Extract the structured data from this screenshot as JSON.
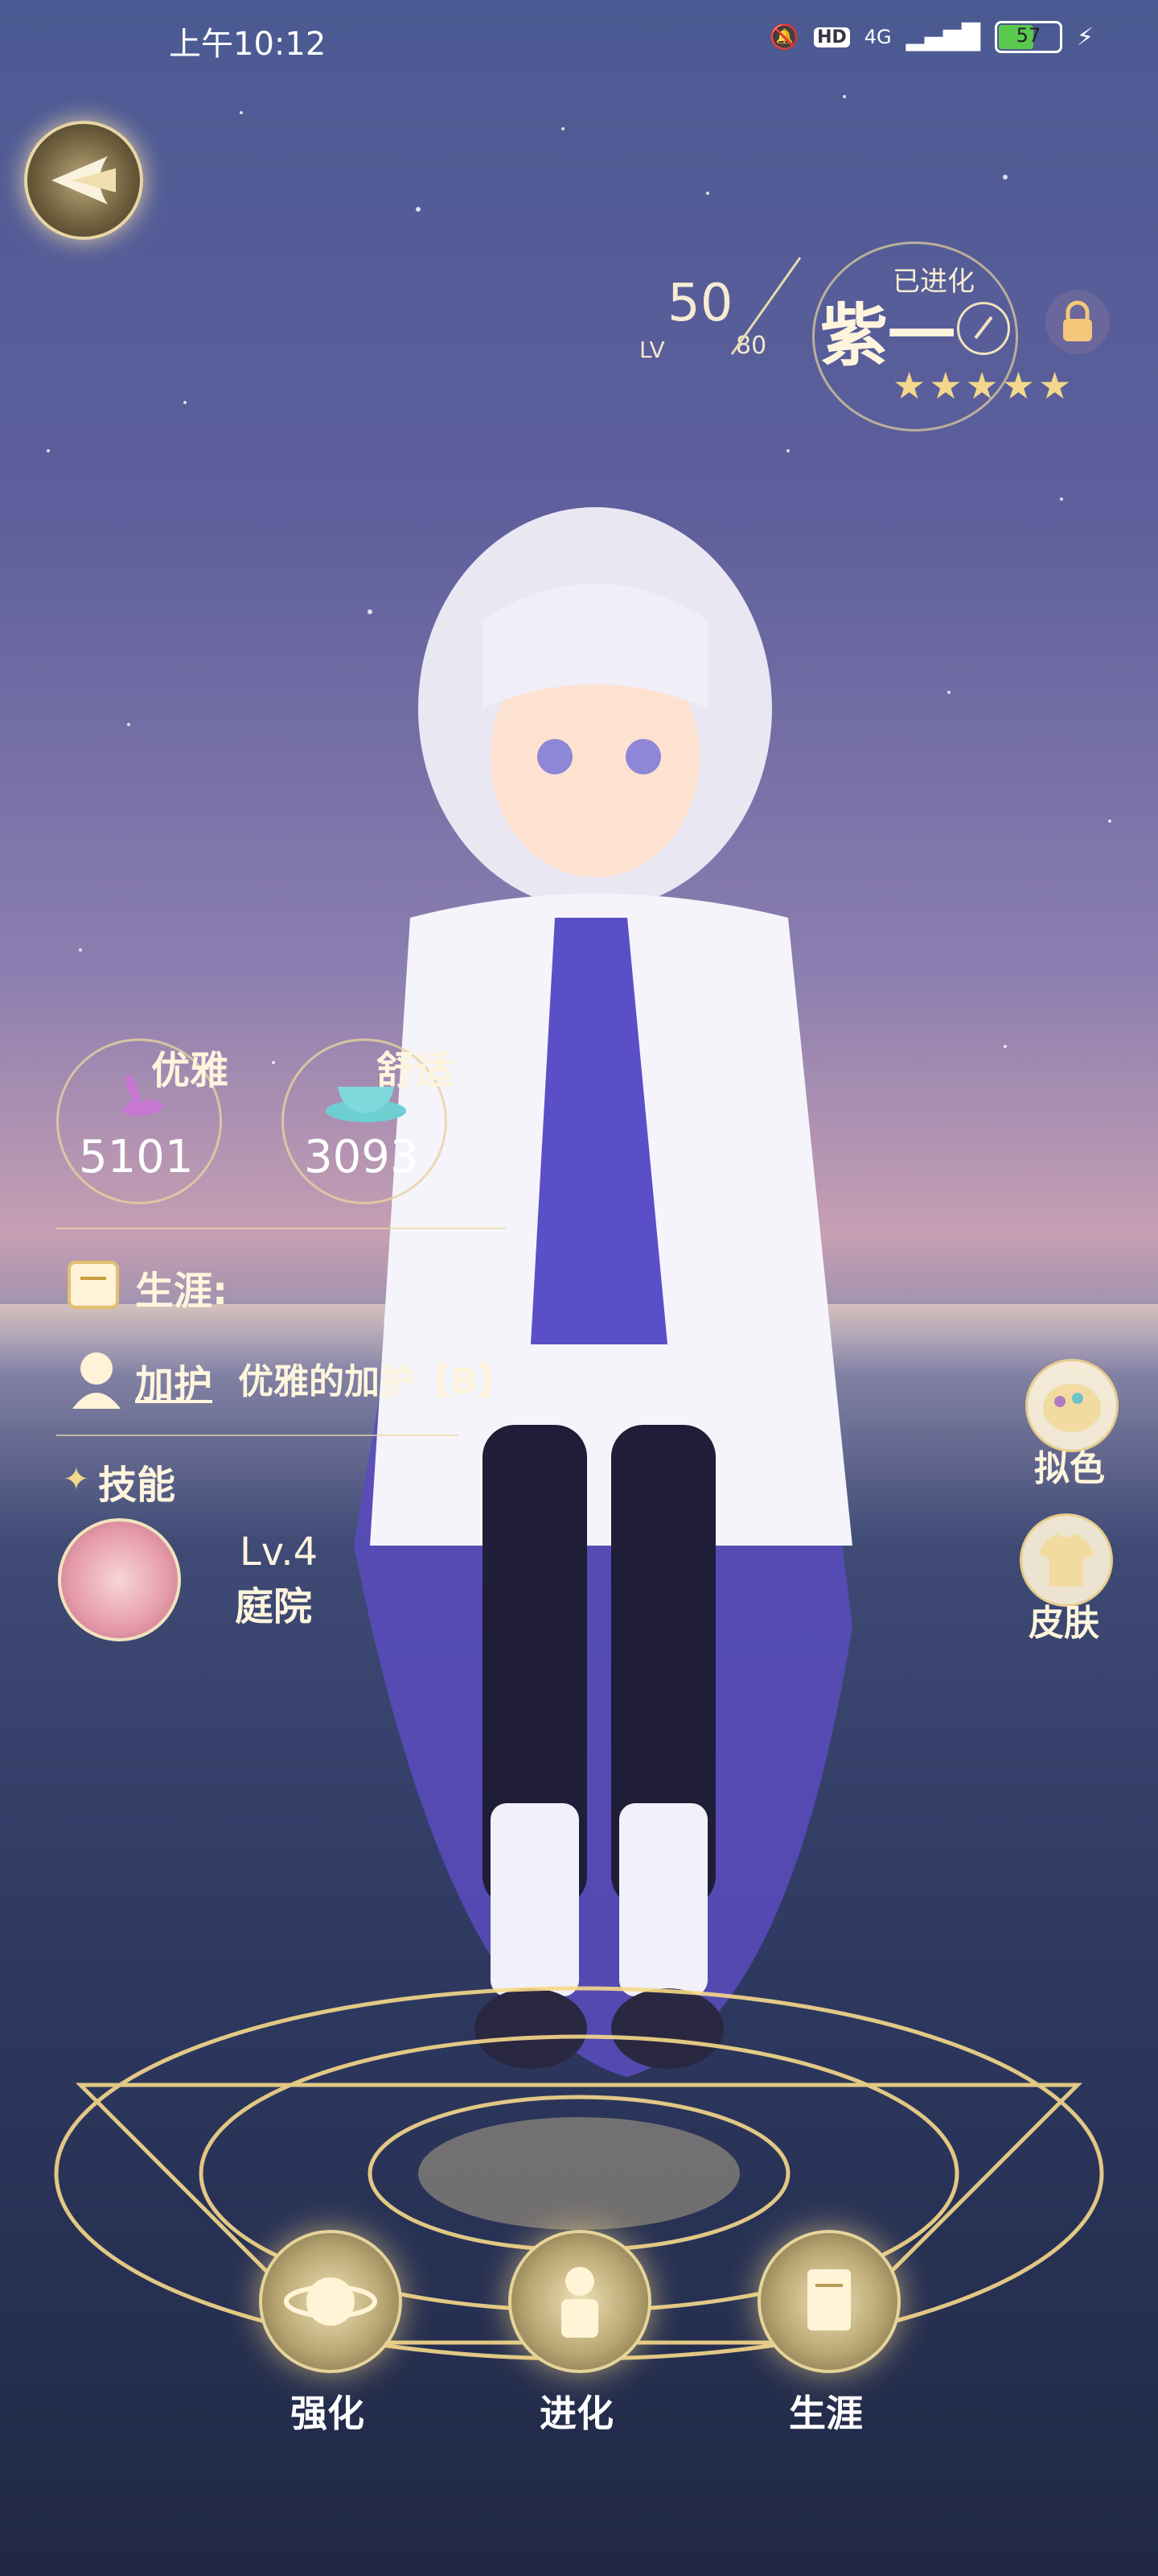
{
  "status_bar": {
    "time": "上午10:12",
    "network": "4G",
    "hd": "HD",
    "battery": "57"
  },
  "character": {
    "level_prefix": "LV",
    "level": "50",
    "level_max": "80",
    "evolved_label": "已进化",
    "name": "紫一",
    "stars": "★★★★★"
  },
  "stats": {
    "elegance_label": "优雅",
    "elegance_value": "5101",
    "comfort_label": "舒适",
    "comfort_value": "3093"
  },
  "info": {
    "career_label": "生涯:",
    "blessing_label": "加护",
    "blessing_value": "优雅的加护【B】",
    "skill_label": "技能"
  },
  "skill": {
    "level": "Lv.4",
    "name": "庭院"
  },
  "side_buttons": {
    "dye": "拟色",
    "skin": "皮肤"
  },
  "bottom_buttons": {
    "enhance": "强化",
    "evolve": "进化",
    "career": "生涯"
  }
}
